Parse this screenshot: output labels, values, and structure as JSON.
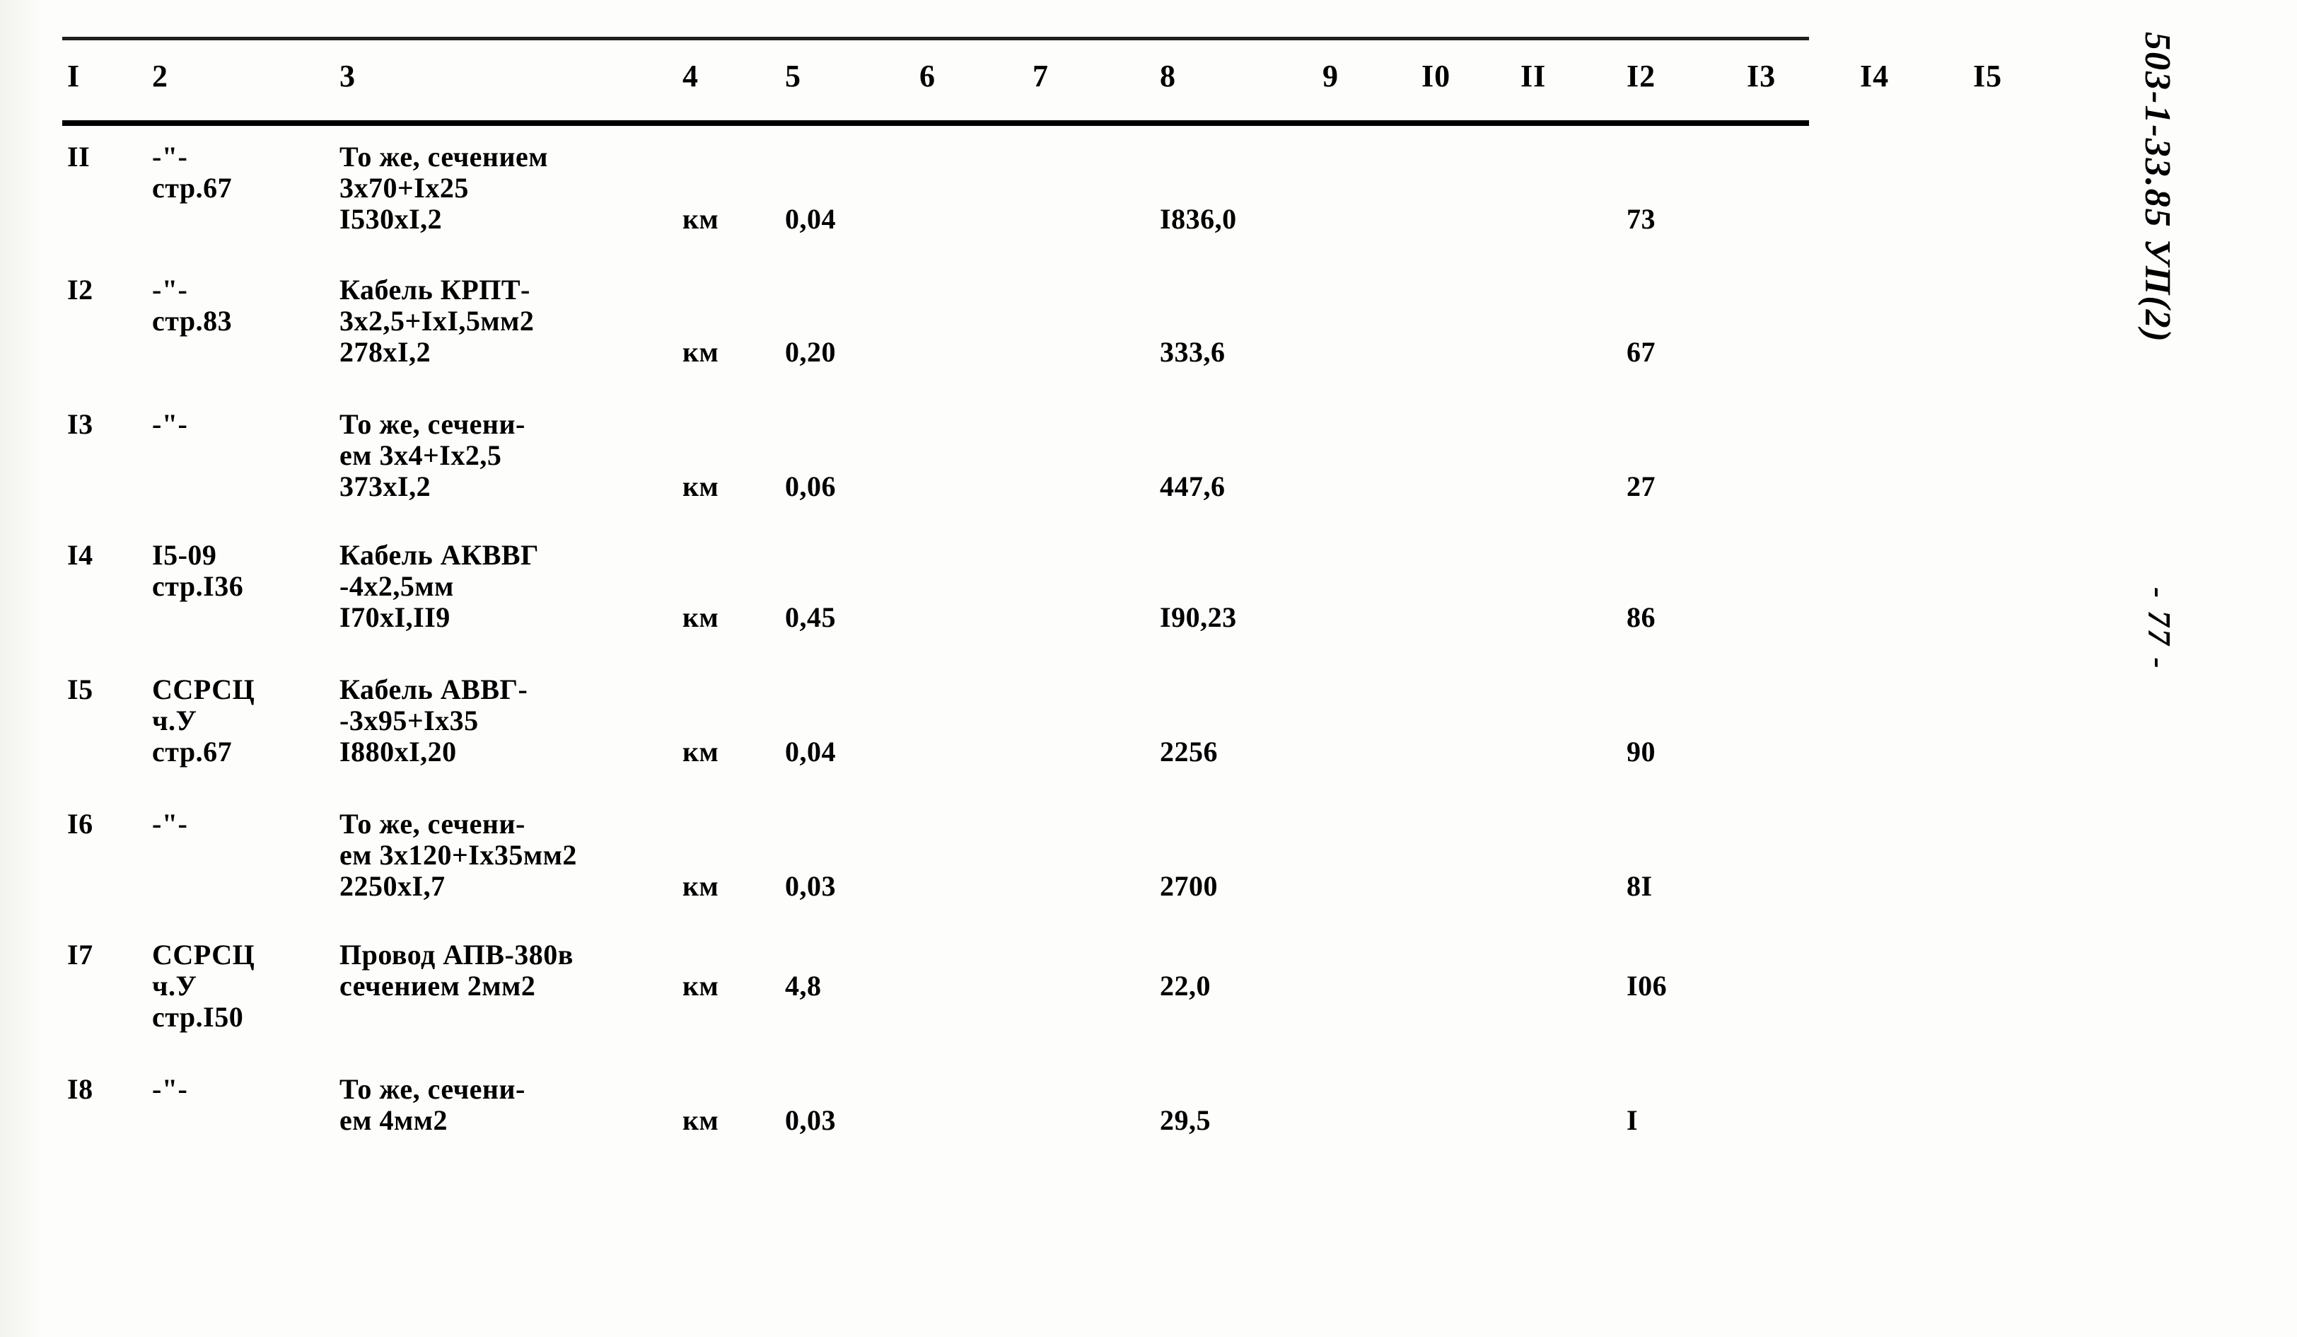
{
  "document": {
    "album_code": "503-1-33.85 УП(2)",
    "page_number": "- 77 -"
  },
  "table": {
    "column_headers": [
      "I",
      "2",
      "3",
      "4",
      "5",
      "6",
      "7",
      "8",
      "9",
      "I0",
      "II",
      "I2",
      "I3",
      "I4",
      "I5"
    ],
    "ditto_mark": "-\"-",
    "rows": [
      {
        "no": "II",
        "source_lines": [
          "-\"-",
          "стр.67"
        ],
        "name_lines": [
          "То же, сечением",
          "3х70+Iх25",
          "I530хI,2"
        ],
        "unit": "км",
        "qty": "0,04",
        "sum": "I836,0",
        "col12": "73"
      },
      {
        "no": "I2",
        "source_lines": [
          "-\"-",
          "стр.83"
        ],
        "name_lines": [
          "Кабель КРПТ-",
          "3х2,5+IхI,5мм2",
          "278хI,2"
        ],
        "unit": "км",
        "qty": "0,20",
        "sum": "333,6",
        "col12": "67"
      },
      {
        "no": "I3",
        "source_lines": [
          "-\"-"
        ],
        "name_lines": [
          "То же, сечени-",
          "ем 3х4+Iх2,5",
          "373хI,2"
        ],
        "unit": "км",
        "qty": "0,06",
        "sum": "447,6",
        "col12": "27"
      },
      {
        "no": "I4",
        "source_lines": [
          "I5-09",
          "стр.I36"
        ],
        "name_lines": [
          "Кабель АКВВГ",
          "-4х2,5мм",
          "I70хI,II9"
        ],
        "unit": "км",
        "qty": "0,45",
        "sum": "I90,23",
        "col12": "86"
      },
      {
        "no": "I5",
        "source_lines": [
          "ССРСЦ",
          "ч.У",
          "стр.67"
        ],
        "name_lines": [
          "Кабель АВВГ-",
          "-3х95+Iх35",
          "I880хI,20"
        ],
        "unit": "км",
        "qty": "0,04",
        "sum": "2256",
        "col12": "90"
      },
      {
        "no": "I6",
        "source_lines": [
          "-\"-"
        ],
        "name_lines": [
          "То же, сечени-",
          "ем 3х120+Iх35мм2",
          "2250хI,7"
        ],
        "unit": "км",
        "qty": "0,03",
        "sum": "2700",
        "col12": "8I"
      },
      {
        "no": "I7",
        "source_lines": [
          "ССРСЦ",
          "ч.У",
          "стр.I50"
        ],
        "name_lines": [
          "Провод АПВ-380в",
          "сечением 2мм2"
        ],
        "unit": "км",
        "qty": "4,8",
        "sum": "22,0",
        "col12": "I06"
      },
      {
        "no": "I8",
        "source_lines": [
          "-\"-"
        ],
        "name_lines": [
          "То же, сечени-",
          "ем 4мм2"
        ],
        "unit": "км",
        "qty": "0,03",
        "sum": "29,5",
        "col12": "I"
      }
    ]
  }
}
